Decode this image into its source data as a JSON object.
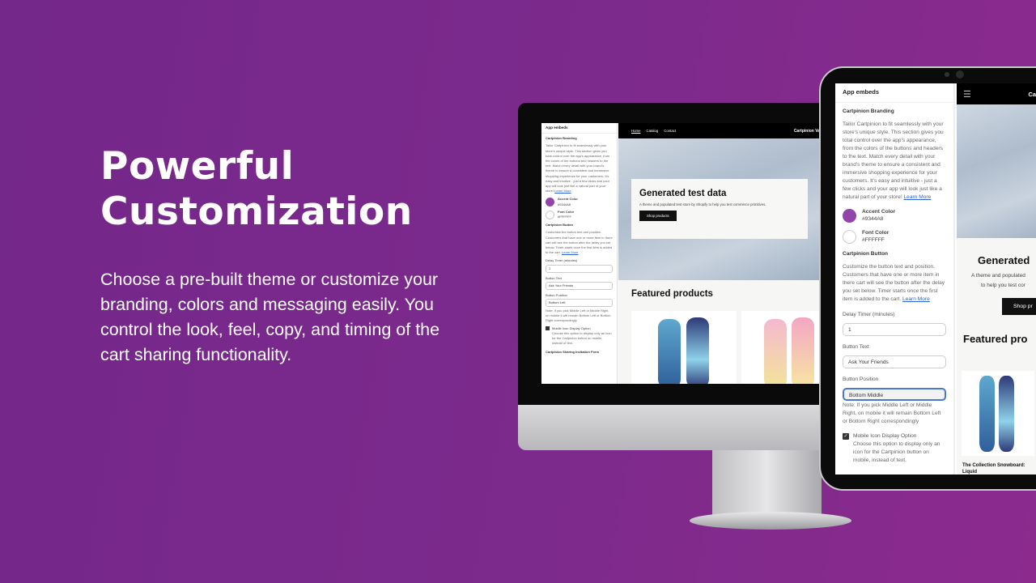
{
  "hero": {
    "title_line1": "Powerful",
    "title_line2": "Customization",
    "description": "Choose a pre-built theme or customize your branding, colors and messaging easily. You control the look, feel, copy, and timing of the cart sharing functionality."
  },
  "colors": {
    "background": "#7a2a8c",
    "accent": "#9344A8",
    "font": "#FFFFFF"
  },
  "editor": {
    "header": "App embeds",
    "branding_title": "Cartpinion Branding",
    "branding_text": "Tailor Cartpinion to fit seamlessly with your store's unique style. This section gives you total control over the app's appearance, from the colors of the buttons and headers to the text. Match every detail with your brand's theme to ensure a consistent and immersive shopping experience for your customers. It's easy and intuitive - just a few clicks and your app will look just like a natural part of your store!",
    "learn_more": "Learn More",
    "accent_label": "Accent Color",
    "accent_value": "#9344A8",
    "font_label": "Font Color",
    "font_value": "#FFFFFF",
    "button_title": "Cartpinion Button",
    "button_text": "Customize the button text and position. Customers that have one or more item in there cart will see the button after the delay you set below. Timer starts once the first item is added to the cart.",
    "delay_label": "Delay Timer (minutes)",
    "delay_value": "1",
    "btntext_label": "Button Text",
    "btntext_value": "Ask Your Friends",
    "position_label": "Button Position",
    "position_value_desktop": "Bottom Left",
    "position_value_tablet": "Bottom Middle",
    "position_note": "Note: If you pick Middle Left or Middle Right, on mobile it will remain Bottom Left or Bottom Right correspondingly",
    "mobile_icon_label": "Mobile Icon Display Option",
    "mobile_icon_checked": true,
    "mobile_icon_text": "Choose this option to display only an icon for the Cartpinion button on mobile, instead of text.",
    "invitation_title": "Cartpinion Sharing Invitation Form"
  },
  "store": {
    "nav": [
      "Home",
      "Catalog",
      "Contact"
    ],
    "brand": "Cartpinion Var",
    "brand_tablet": "Cartpinion",
    "hero_title": "Generated test data",
    "hero_title_tablet": "Generated",
    "hero_text": "A theme and populated test store by Shopify to help you test commerce primitives.",
    "hero_text_tablet_1": "A theme and populated",
    "hero_text_tablet_2": "to help you test cor",
    "shop_button": "Shop products",
    "shop_button_tablet": "Shop pr",
    "featured": "Featured products",
    "featured_tablet": "Featured pro",
    "product_1": "The Collection Snowboard: Liquid"
  }
}
